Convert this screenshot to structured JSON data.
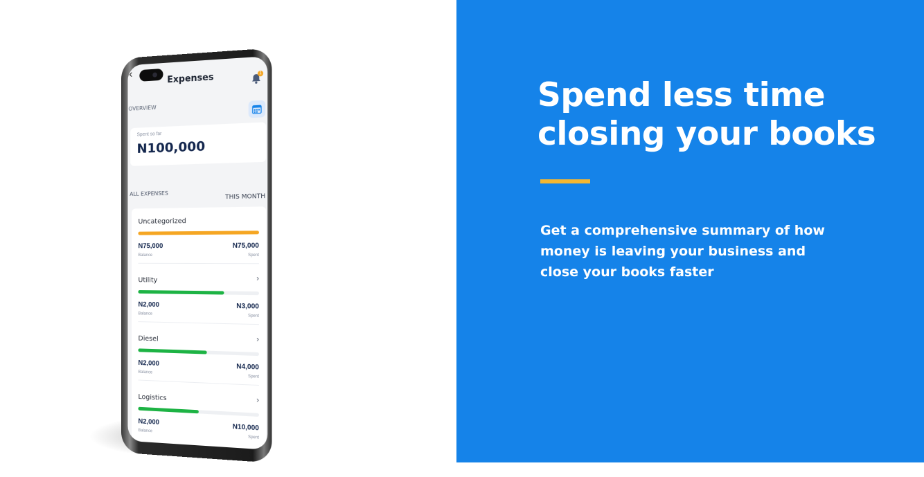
{
  "colors": {
    "brand_blue": "#1583E9",
    "accent_yellow": "#F5B731",
    "bar_orange": "#F5A623",
    "bar_green": "#1DB344",
    "navy": "#13264D"
  },
  "phone": {
    "title": "Expenses",
    "back_icon": "chevron-left-icon",
    "notification_icon": "bell-icon",
    "notification_count": "1",
    "overview_label": "OVERVIEW",
    "calendar_icon": "calendar-icon",
    "spent_label": "Spent so far",
    "spent_value": "N100,000",
    "all_expenses_label": "ALL EXPENSES",
    "period_label": "THIS MONTH",
    "categories": [
      {
        "name": "Uncategorized",
        "progress": 1.0,
        "color": "#F5A623",
        "balance": "N75,000",
        "balance_label": "Balance",
        "spent": "N75,000",
        "spent_label": "Spent"
      },
      {
        "name": "Utility",
        "progress": 0.72,
        "color": "#1DB344",
        "balance": "N2,000",
        "balance_label": "Balance",
        "spent": "N3,000",
        "spent_label": "Spent"
      },
      {
        "name": "Diesel",
        "progress": 0.58,
        "color": "#1DB344",
        "balance": "N2,000",
        "balance_label": "Balance",
        "spent": "N4,000",
        "spent_label": "Spent"
      },
      {
        "name": "Logistics",
        "progress": 0.51,
        "color": "#1DB344",
        "balance": "N2,000",
        "balance_label": "Balance",
        "spent": "N10,000",
        "spent_label": "Spent"
      }
    ]
  },
  "panel": {
    "headline": "Spend less time closing your books",
    "description": "Get a comprehensive summary of how money is leaving your business and close your books faster"
  }
}
